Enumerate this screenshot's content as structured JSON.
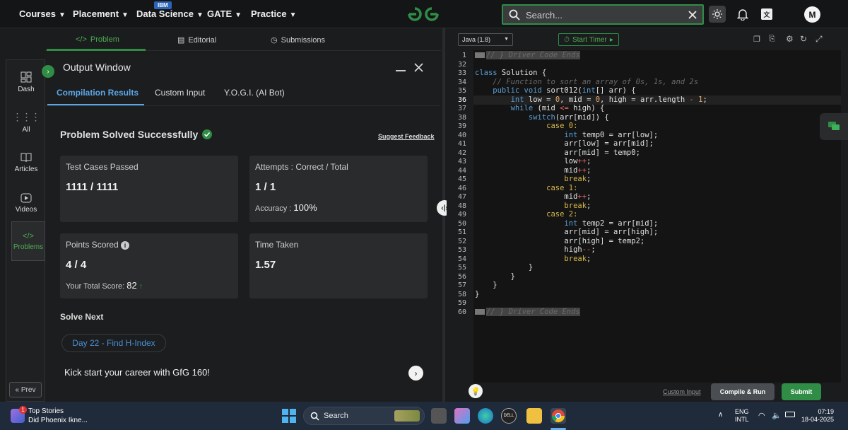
{
  "nav": {
    "items": [
      "Courses",
      "Placement",
      "Data Science",
      "GATE",
      "Practice"
    ],
    "badge": "IBM",
    "search_placeholder": "Search...",
    "avatar": "M"
  },
  "problem_tabs": [
    "Problem",
    "Editorial",
    "Submissions"
  ],
  "sidebar": {
    "items": [
      "Dash",
      "All",
      "Articles",
      "Videos",
      "Problems"
    ],
    "prev": "« Prev"
  },
  "output": {
    "title": "Output Window",
    "tabs": [
      "Compilation Results",
      "Custom Input",
      "Y.O.G.I. (AI Bot)"
    ],
    "status": "Problem Solved Successfully",
    "feedback": "Suggest Feedback",
    "cards": {
      "tests_label": "Test Cases Passed",
      "tests_value": "1111 / 1111",
      "attempts_label": "Attempts : Correct / Total",
      "attempts_value": "1 / 1",
      "accuracy_label": "Accuracy :",
      "accuracy_value": "100%",
      "points_label": "Points Scored",
      "points_value": "4 / 4",
      "total_label": "Your Total Score:",
      "total_value": "82",
      "time_label": "Time Taken",
      "time_value": "1.57"
    },
    "solve_next": "Solve Next",
    "next_problem": "Day 22 - Find H-Index",
    "kickstart": "Kick start your career with GfG 160!"
  },
  "editor": {
    "language": "Java (1.8)",
    "timer": "Start Timer",
    "line_numbers": [
      "1",
      "32",
      "33",
      "34",
      "35",
      "36",
      "37",
      "38",
      "39",
      "40",
      "41",
      "42",
      "43",
      "44",
      "45",
      "46",
      "47",
      "48",
      "49",
      "50",
      "51",
      "52",
      "53",
      "54",
      "55",
      "56",
      "57",
      "58",
      "59",
      "60"
    ],
    "custom_input": "Custom Input",
    "compile_run": "Compile & Run",
    "submit": "Submit"
  },
  "taskbar": {
    "news_title": "Top Stories",
    "news_sub": "Did Phoenix Ikne...",
    "news_count": "1",
    "search": "Search",
    "lang": "ENG",
    "layout": "INTL",
    "time": "07:19",
    "date": "18-04-2025"
  },
  "colors": {
    "accent": "#2f8d46",
    "link": "#5aa7e8",
    "bg": "#1b1c1e"
  }
}
